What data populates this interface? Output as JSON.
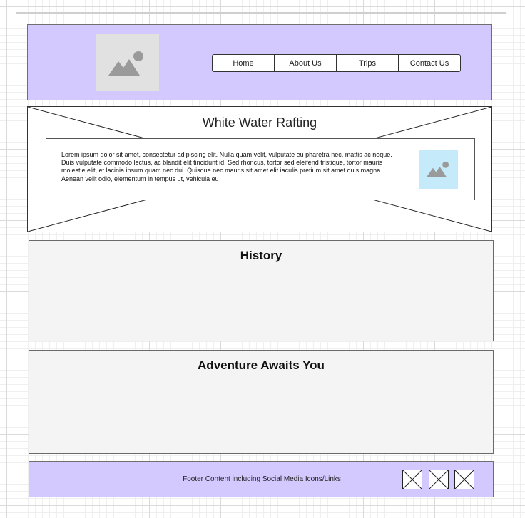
{
  "header": {
    "logo_icon": "image-placeholder-icon",
    "nav": [
      "Home",
      "About Us",
      "Trips",
      "Contact Us"
    ]
  },
  "hero": {
    "title": "White Water Rafting",
    "body": "Lorem ipsum dolor sit amet, consectetur adipiscing elit. Nulla quam velit, vulputate eu pharetra nec, mattis ac neque. Duis vulputate commodo lectus, ac blandit elit tincidunt id. Sed rhoncus, tortor sed eleifend tristique, tortor mauris molestie elit, et lacinia ipsum quam nec dui. Quisque nec mauris sit amet elit iaculis pretium sit amet quis magna. Aenean velit odio, elementum in tempus ut, vehicula eu",
    "thumb_icon": "image-placeholder-icon"
  },
  "sections": {
    "history_title": "History",
    "adventure_title": "Adventure Awaits You"
  },
  "footer": {
    "text": "Footer Content including Social Media Icons/Links",
    "social_icons": [
      "social-media-placeholder-icon",
      "social-media-placeholder-icon",
      "social-media-placeholder-icon"
    ]
  },
  "colors": {
    "header_bg": "#d4c9fe",
    "footer_bg": "#d4c9fe",
    "thumb_bg": "#c5ebfb",
    "section_bg": "#f4f4f4"
  }
}
